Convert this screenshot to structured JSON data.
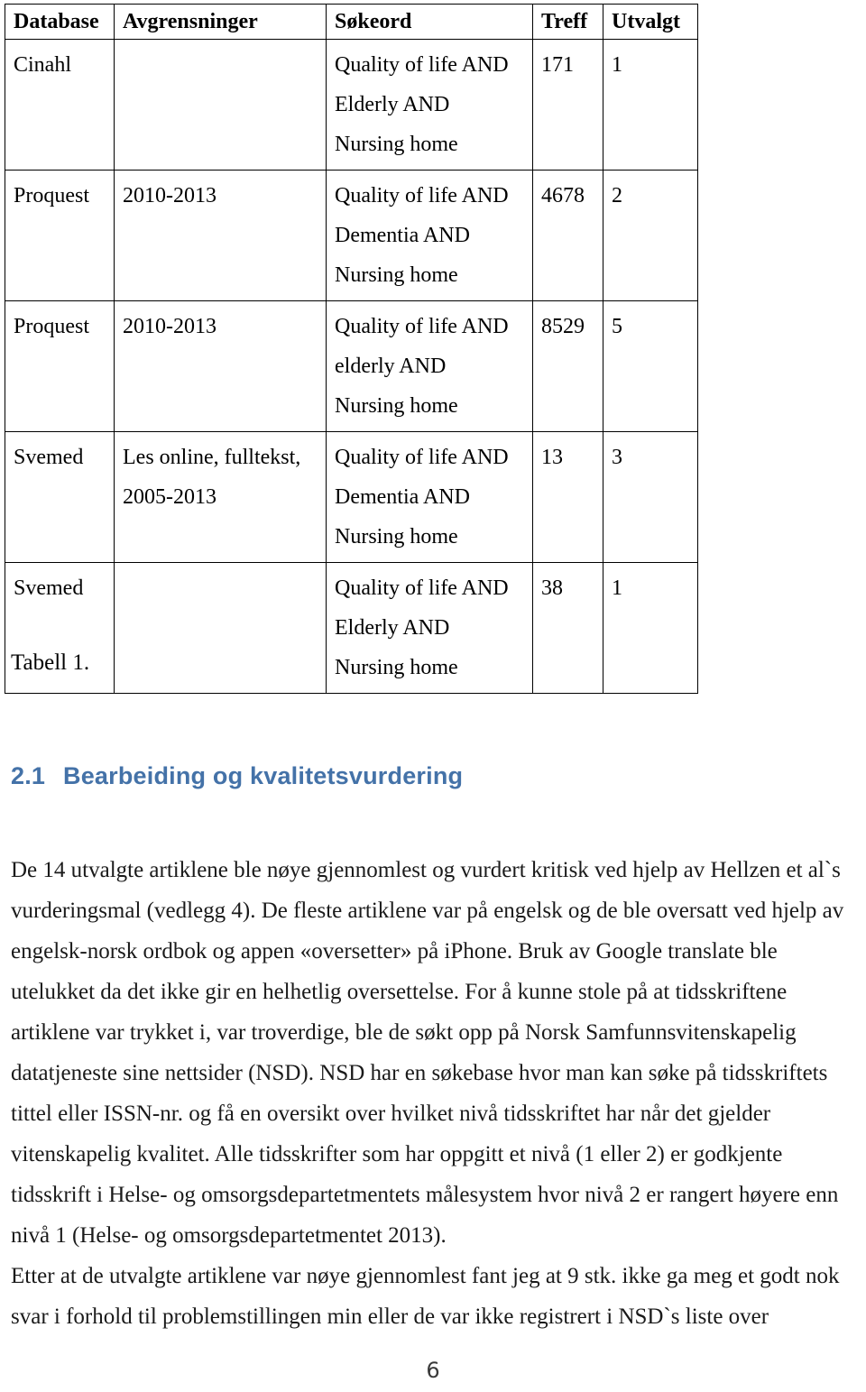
{
  "document": {
    "page_number": "6"
  },
  "table": {
    "caption": "Tabell 1.",
    "headers": {
      "database": "Database",
      "avgrensninger": "Avgrensninger",
      "sokeord": "Søkeord",
      "treff": "Treff",
      "utvalgt": "Utvalgt"
    },
    "rows": [
      {
        "database": "Cinahl",
        "avgrensninger": "",
        "avgrensninger_line2": "",
        "sokeord_line1": "Quality of life AND",
        "sokeord_line2": "Elderly AND",
        "sokeord_line3": "Nursing home",
        "treff": "171",
        "utvalgt": "1"
      },
      {
        "database": "Proquest",
        "avgrensninger": "2010-2013",
        "avgrensninger_line2": "",
        "sokeord_line1": "Quality of life AND",
        "sokeord_line2": "Dementia AND",
        "sokeord_line3": "Nursing home",
        "treff": "4678",
        "utvalgt": "2"
      },
      {
        "database": "Proquest",
        "avgrensninger": "2010-2013",
        "avgrensninger_line2": "",
        "sokeord_line1": "Quality of life AND",
        "sokeord_line2": "elderly AND",
        "sokeord_line3": "Nursing home",
        "treff": "8529",
        "utvalgt": "5"
      },
      {
        "database": "Svemed",
        "avgrensninger": "Les online, fulltekst,",
        "avgrensninger_line2": "2005-2013",
        "sokeord_line1": "Quality of life AND",
        "sokeord_line2": "Dementia AND",
        "sokeord_line3": "Nursing home",
        "treff": "13",
        "utvalgt": "3"
      },
      {
        "database": "Svemed",
        "avgrensninger": "",
        "avgrensninger_line2": "",
        "sokeord_line1": "Quality of life AND",
        "sokeord_line2": "Elderly AND",
        "sokeord_line3": "Nursing home",
        "treff": "38",
        "utvalgt": "1"
      }
    ]
  },
  "heading": {
    "number": "2.1",
    "text": "Bearbeiding og kvalitetsvurdering",
    "color": "#4472A8"
  },
  "paragraph_1": {
    "line1": "De 14 utvalgte artiklene ble nøye gjennomlest og vurdert kritisk ved hjelp av Hellzen et al`s",
    "line2": "vurderingsmal (vedlegg 4). De fleste artiklene var på engelsk og de ble oversatt ved hjelp av",
    "line3": "engelsk-norsk ordbok og appen «oversetter» på iPhone. Bruk av Google translate ble",
    "line4": "utelukket da det ikke gir en helhetlig oversettelse. For å kunne stole på at tidsskriftene",
    "line5": "artiklene var trykket i, var troverdige, ble de søkt opp på Norsk Samfunnsvitenskapelig",
    "line6": "datatjeneste sine nettsider (NSD). NSD har en søkebase hvor man kan søke på tidsskriftets",
    "line7": "tittel eller ISSN-nr. og få en oversikt over hvilket nivå tidsskriftet har når det gjelder",
    "line8": "vitenskapelig kvalitet. Alle tidsskrifter som har oppgitt et nivå (1 eller 2) er godkjente",
    "line9": "tidsskrift i Helse- og omsorgsdepartetmentets målesystem hvor nivå 2 er rangert høyere enn",
    "line10": "nivå 1 (Helse- og omsorgsdepartetmentet 2013)."
  },
  "paragraph_2": {
    "line1": "Etter at de utvalgte artiklene var nøye gjennomlest fant jeg at 9 stk. ikke ga meg et godt nok",
    "line2": "svar i forhold til problemstillingen min eller de var ikke registrert i NSD`s liste over"
  }
}
